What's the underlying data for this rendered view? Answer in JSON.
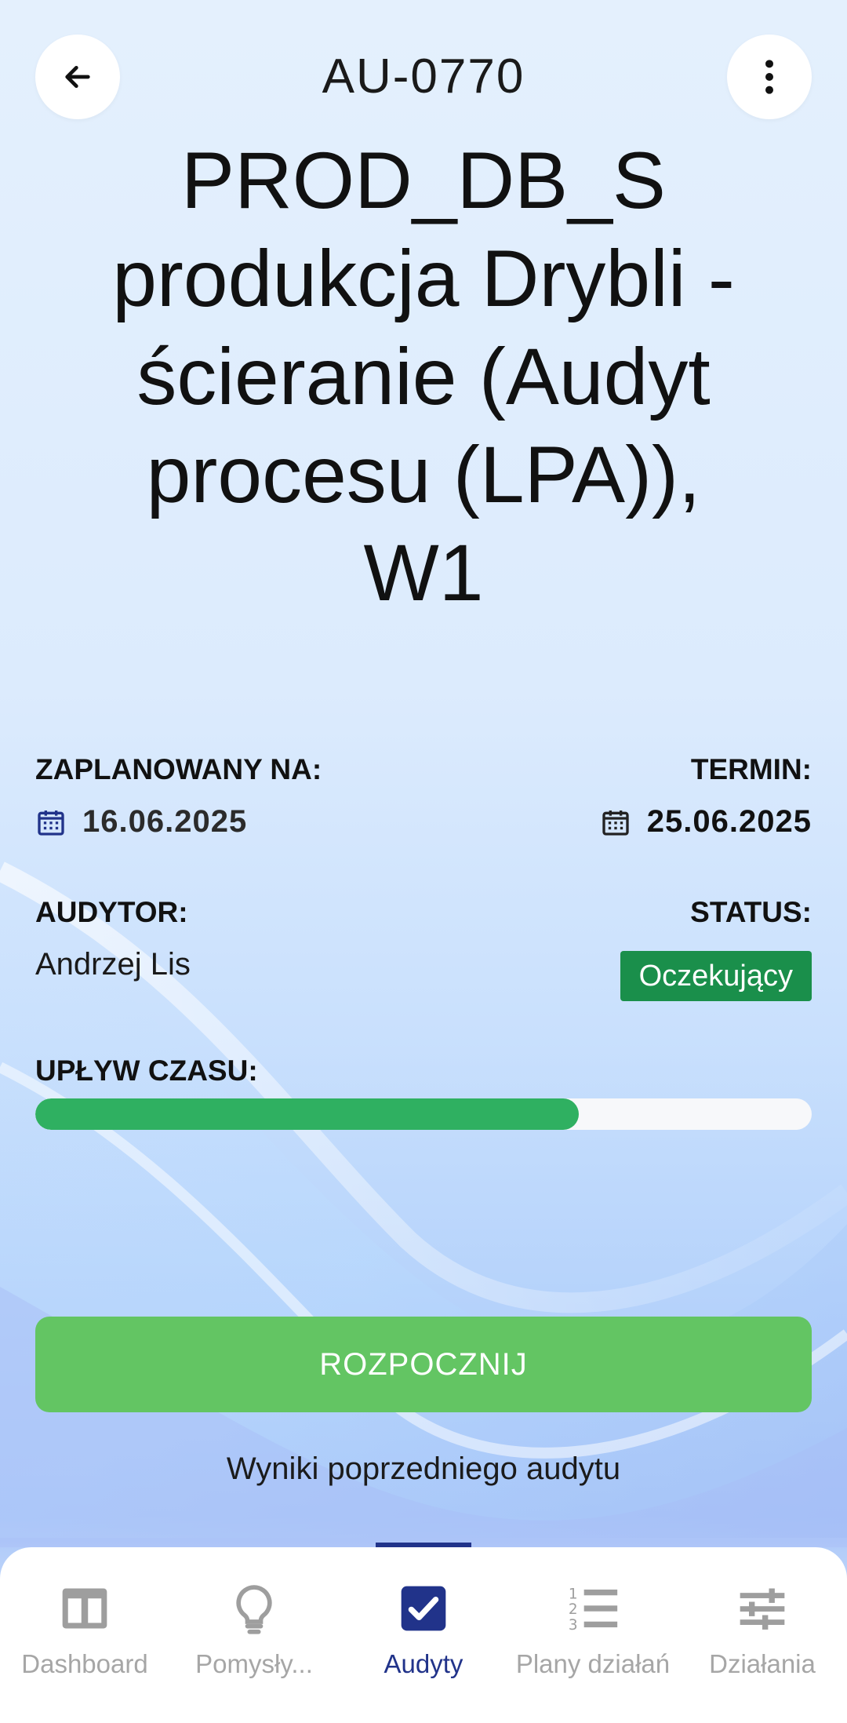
{
  "header": {
    "code": "AU-0770",
    "title": "PROD_DB_S produkcja Drybli - ścieranie (Audyt procesu (LPA)), W1"
  },
  "details": {
    "planned_label": "ZAPLANOWANY NA:",
    "planned_date": "16.06.2025",
    "deadline_label": "TERMIN:",
    "deadline_date": "25.06.2025",
    "auditor_label": "AUDYTOR:",
    "auditor_name": "Andrzej Lis",
    "status_label": "STATUS:",
    "status_value": "Oczekujący",
    "status_color": "#1a8f4b"
  },
  "progress": {
    "label": "UPŁYW CZASU:",
    "fraction": 0.7,
    "fill_color": "#2fb061"
  },
  "actions": {
    "start_label": "ROZPOCZNIJ",
    "previous_results_label": "Wyniki poprzedniego audytu"
  },
  "nav": {
    "active_index": 2,
    "items": [
      {
        "label": "Dashboard",
        "icon": "dashboard-icon"
      },
      {
        "label": "Pomysły...",
        "icon": "lightbulb-icon"
      },
      {
        "label": "Audyty",
        "icon": "checkbox-icon"
      },
      {
        "label": "Plany działań",
        "icon": "numbered-list-icon"
      },
      {
        "label": "Działania",
        "icon": "sliders-icon"
      }
    ]
  }
}
